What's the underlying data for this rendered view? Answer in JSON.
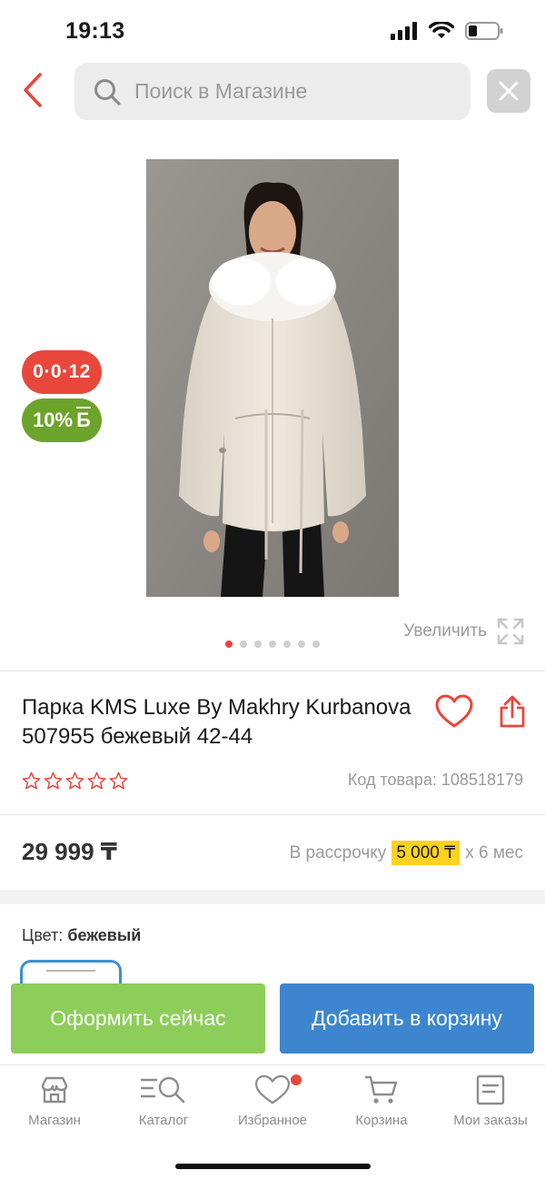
{
  "status_bar": {
    "time": "19:13"
  },
  "search": {
    "placeholder": "Поиск в Магазине"
  },
  "badges": {
    "installment": "0·0·12",
    "bonus": "10%",
    "bonus_currency": "Б"
  },
  "gallery": {
    "zoom_label": "Увеличить",
    "dots_total": 7,
    "active_dot": 1
  },
  "product": {
    "title": "Парка KMS Luxe By Makhry Kurbanova 507955 бежевый 42-44",
    "rating_stars": 5,
    "rating_value": 0,
    "sku_label": "Код товара: 108518179",
    "price": "29 999 ₸",
    "installment_prefix": "В рассрочку",
    "installment_amount": "5 000 ₸",
    "installment_suffix": "x 6 мес",
    "color_label": "Цвет:",
    "color_value": "бежевый"
  },
  "actions": {
    "checkout": "Оформить сейчас",
    "add_to_cart": "Добавить в корзину"
  },
  "tabbar": {
    "items": [
      {
        "label": "Магазин",
        "icon": "store-icon"
      },
      {
        "label": "Каталог",
        "icon": "catalog-search-icon"
      },
      {
        "label": "Избранное",
        "icon": "heart-icon",
        "has_dot": true
      },
      {
        "label": "Корзина",
        "icon": "cart-icon"
      },
      {
        "label": "Мои заказы",
        "icon": "orders-icon"
      }
    ]
  },
  "colors": {
    "accent_red": "#e8473b",
    "bonus_green": "#6ba32b",
    "checkout_green": "#8dcd5a",
    "cart_blue": "#3d86cf",
    "highlight_yellow": "#ffd21f"
  }
}
